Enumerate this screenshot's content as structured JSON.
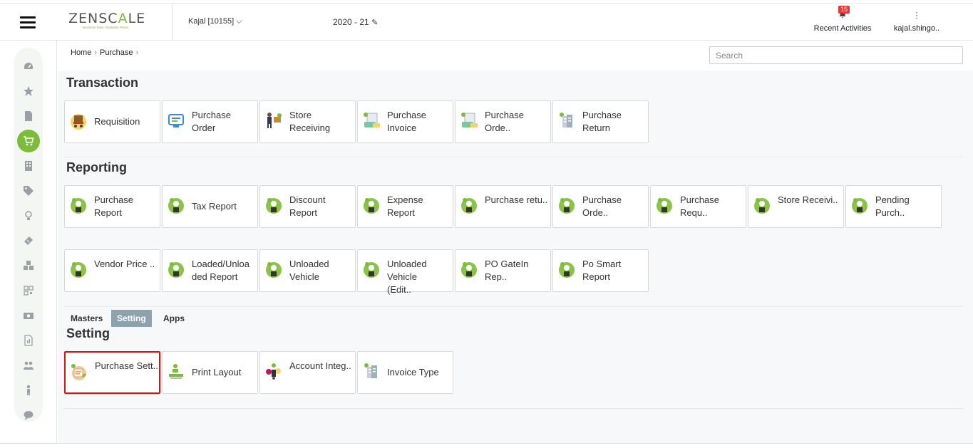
{
  "header": {
    "logo_main": "ZENSC",
    "logo_accent": "A",
    "logo_end": "LE",
    "tagline": "Business Ease, Business Peace",
    "company": "Kajal [10155]",
    "financial_year": "2020 - 21",
    "recent_badge": "15",
    "recent_label": "Recent Activities",
    "user_label": "kajal.shingo.."
  },
  "breadcrumb": {
    "home": "Home",
    "current": "Purchase"
  },
  "search": {
    "placeholder": "Search"
  },
  "sections": {
    "transaction": {
      "title": "Transaction",
      "tiles": [
        "Requisition",
        "Purchase Order",
        "Store Receiving",
        "Purchase Invoice",
        "Purchase Orde..",
        "Purchase Return"
      ]
    },
    "reporting": {
      "title": "Reporting",
      "tiles": [
        "Purchase Report",
        "Tax Report",
        "Discount Report",
        "Expense Report",
        "Purchase retu..",
        "Purchase Orde..",
        "Purchase Requ..",
        "Store Receivi..",
        "Pending Purch..",
        "Vendor Price ..",
        "Loaded/Unloaded Report",
        "Unloaded Vehicle",
        "Unloaded Vehicle (Edit..",
        "PO GateIn Rep..",
        "Po Smart Report"
      ]
    },
    "setting": {
      "title": "Setting",
      "tiles": [
        "Purchase Sett..",
        "Print Layout",
        "Account Integ..",
        "Invoice Type"
      ]
    }
  },
  "tabs": [
    "Masters",
    "Setting",
    "Apps"
  ],
  "colors": {
    "accent": "#7dbb3b",
    "highlight": "#e01010",
    "tab_active": "#8ca2ad"
  }
}
